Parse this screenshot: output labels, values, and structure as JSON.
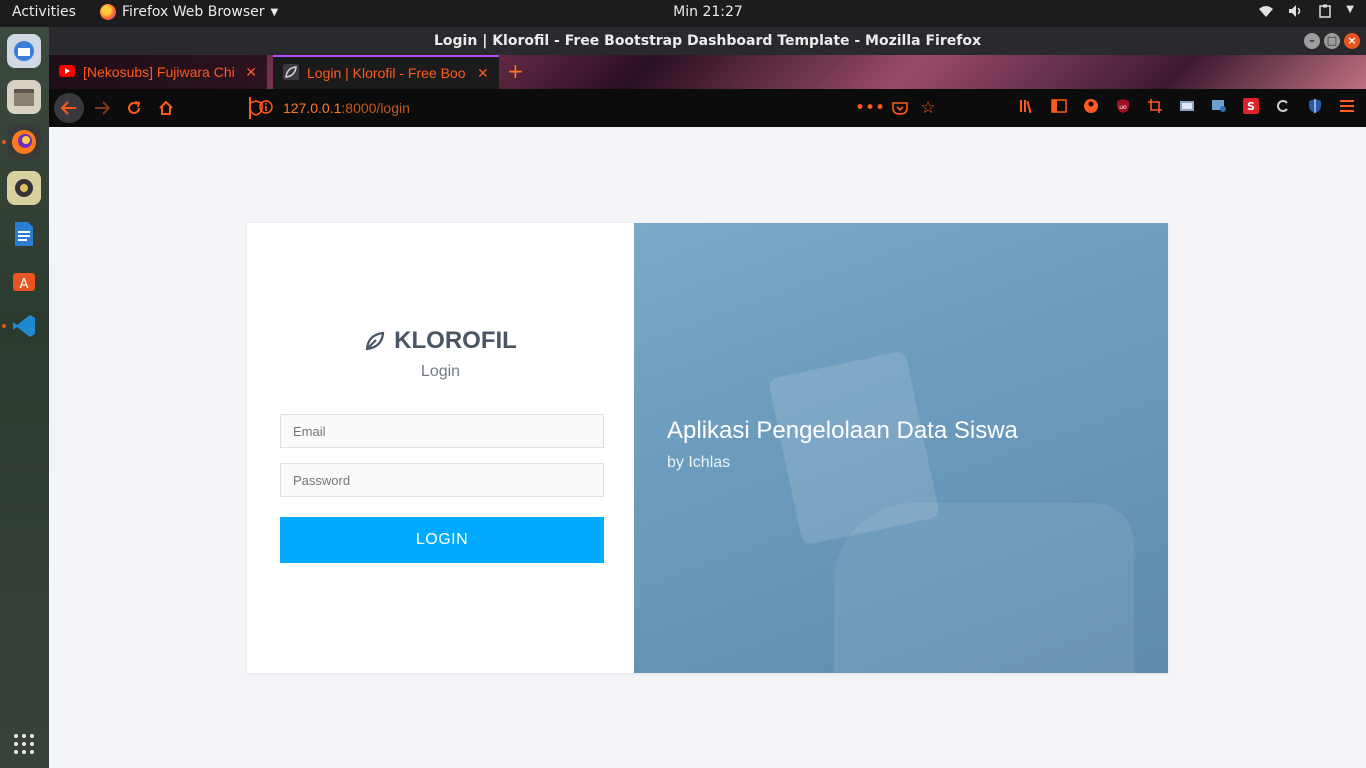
{
  "topbar": {
    "activities": "Activities",
    "app_name": "Firefox Web Browser",
    "clock": "Min 21:27"
  },
  "window": {
    "title": "Login | Klorofil - Free Bootstrap Dashboard Template - Mozilla Firefox"
  },
  "tabs": [
    {
      "title": "[Nekosubs] Fujiwara Chi",
      "icon": "youtube-icon"
    },
    {
      "title": "Login | Klorofil - Free Boo",
      "icon": "klorofil-leaf-icon"
    }
  ],
  "url": {
    "host": "127.0.0.1",
    "path": ":8000/login"
  },
  "login": {
    "brand": "KLOROFIL",
    "subtitle": "Login",
    "email_placeholder": "Email",
    "password_placeholder": "Password",
    "button": "LOGIN"
  },
  "hero": {
    "heading": "Aplikasi Pengelolaan Data Siswa",
    "byline": "by Ichlas"
  },
  "colors": {
    "accent": "#00aaff",
    "firefox_orange": "#ff5a1f",
    "hero_blue": "#6c9cbd",
    "page_bg": "#f3f4f8"
  }
}
